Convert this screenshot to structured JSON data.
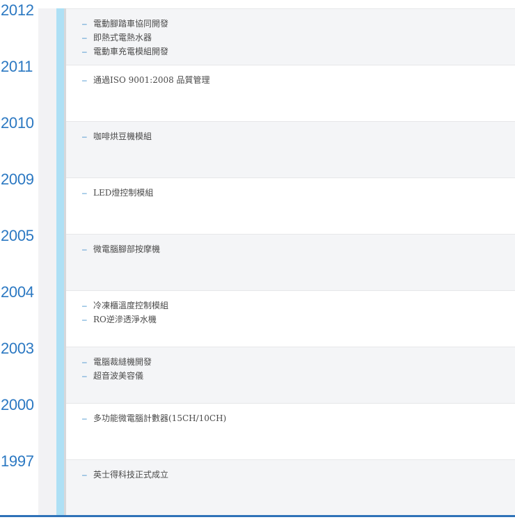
{
  "timeline": {
    "entries": [
      {
        "year": "2012",
        "items": [
          "電動腳踏車協同開發",
          "即熱式電熱水器",
          "電動車充電模組開發"
        ]
      },
      {
        "year": "2011",
        "items": [
          "通過ISO 9001:2008 品質管理"
        ]
      },
      {
        "year": "2010",
        "items": [
          "咖啡烘豆機模組"
        ]
      },
      {
        "year": "2009",
        "items": [
          "LED燈控制模組"
        ]
      },
      {
        "year": "2005",
        "items": [
          "微電腦腳部按摩機"
        ]
      },
      {
        "year": "2004",
        "items": [
          "冷凍櫃溫度控制模組",
          "RO逆滲透淨水機"
        ]
      },
      {
        "year": "2003",
        "items": [
          "電腦裁縫機開發",
          "超音波美容儀"
        ]
      },
      {
        "year": "2000",
        "items": [
          "多功能微電腦計數器(15CH/10CH)"
        ]
      },
      {
        "year": "1997",
        "items": [
          "英士得科技正式成立"
        ]
      }
    ],
    "bullet": "–"
  },
  "colors": {
    "year": "#2b78c2",
    "rail": "#aee0f5",
    "bottom_line": "#2e72b8",
    "band_alt": "#f4f5f7"
  }
}
